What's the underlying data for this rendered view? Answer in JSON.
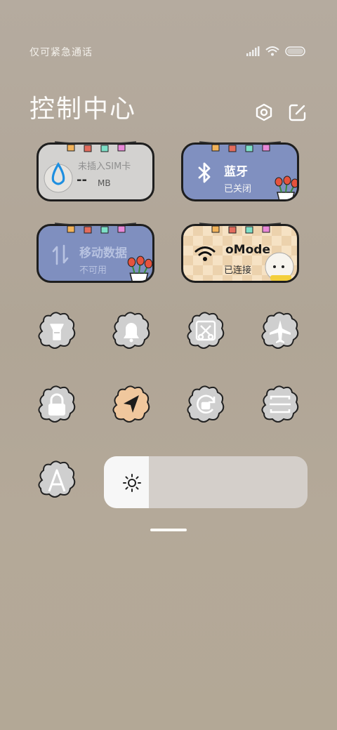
{
  "status_bar": {
    "carrier": "仅可紧急通话",
    "icons": [
      "signal-icon",
      "wifi-icon",
      "battery-icon"
    ]
  },
  "header": {
    "title": "控制中心",
    "icons": [
      "settings-icon",
      "edit-icon"
    ]
  },
  "tiles": {
    "sim": {
      "label": "未插入SIM卡",
      "data_value": "--",
      "data_unit": "MB",
      "icon": "data-usage-icon"
    },
    "bluetooth": {
      "label": "蓝牙",
      "status": "已关闭",
      "icon": "bluetooth-icon"
    },
    "mobile_data": {
      "label": "移动数据",
      "status": "不可用",
      "icon": "mobile-data-icon"
    },
    "wifi": {
      "label": "oMode",
      "status": "已连接",
      "icon": "wifi-icon"
    }
  },
  "toggles": [
    {
      "name": "flashlight-toggle",
      "icon": "flashlight-icon"
    },
    {
      "name": "silent-toggle",
      "icon": "bell-icon"
    },
    {
      "name": "screenshot-toggle",
      "icon": "scissors-icon"
    },
    {
      "name": "airplane-toggle",
      "icon": "airplane-icon"
    },
    {
      "name": "lock-screen-toggle",
      "icon": "lock-icon"
    },
    {
      "name": "location-toggle",
      "icon": "location-arrow-icon",
      "active": true
    },
    {
      "name": "rotation-lock-toggle",
      "icon": "rotation-lock-icon"
    },
    {
      "name": "screen-cast-toggle",
      "icon": "screen-cast-icon"
    },
    {
      "name": "auto-brightness-toggle",
      "icon": "auto-brightness-icon"
    }
  ],
  "brightness": {
    "level": 0.22,
    "icon": "sun-icon"
  },
  "colors": {
    "tile_gray": "#d3d2d0",
    "tile_blue": "#7f8fbf",
    "tile_beige": "#f6e2c4",
    "bubble_gray": "#cfcfcf",
    "bubble_active": "#f0c79d"
  }
}
